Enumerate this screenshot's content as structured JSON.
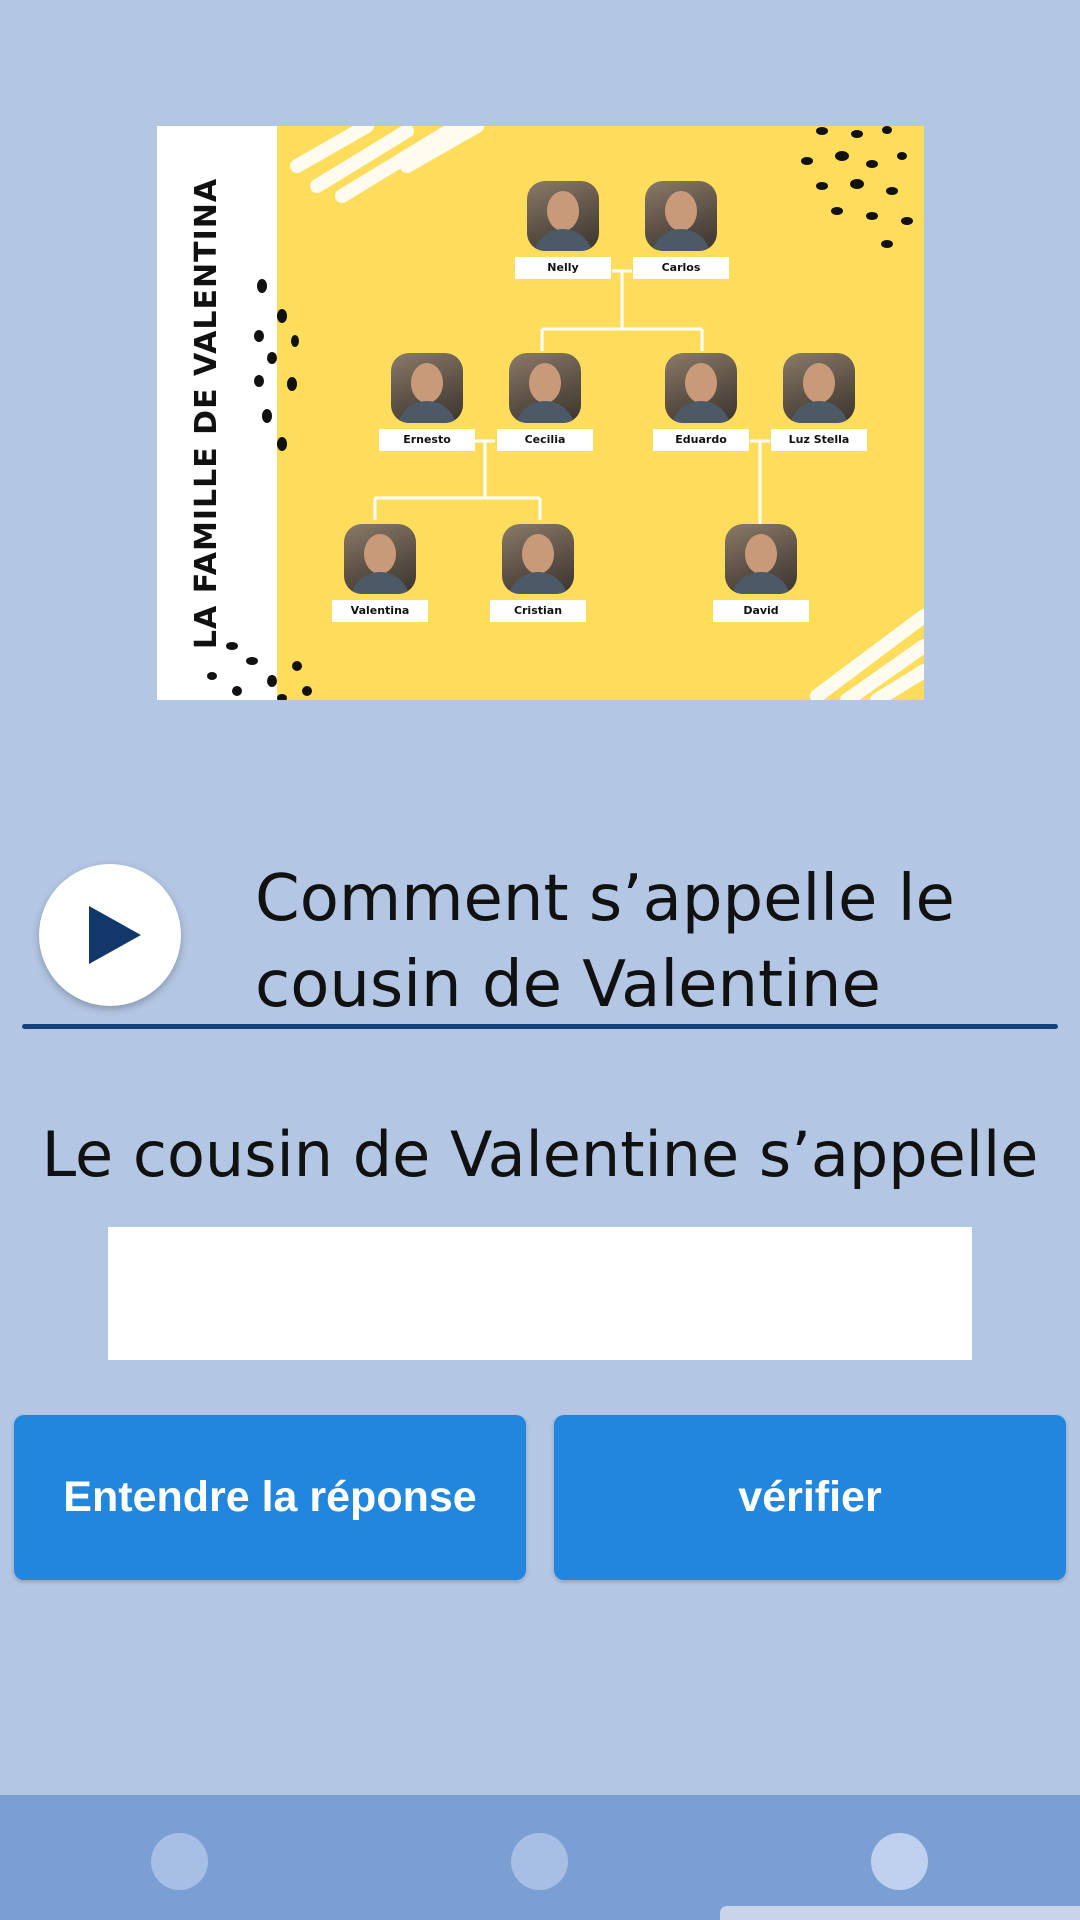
{
  "image": {
    "title": "LA FAMILLE DE VALENTINA",
    "people": {
      "nelly": "Nelly",
      "carlos": "Carlos",
      "ernesto": "Ernesto",
      "cecilia": "Cecilia",
      "eduardo": "Eduardo",
      "luz_stella": "Luz Stella",
      "valentina": "Valentina",
      "cristian": "Cristian",
      "david": "David"
    },
    "background_color": "#ffdd5c"
  },
  "question": {
    "text": "Comment s’appelle le cousin de Valentine",
    "play_icon": "play-icon"
  },
  "answer": {
    "prompt": "Le cousin de Valentine s’appelle",
    "value": "",
    "placeholder": ""
  },
  "buttons": {
    "listen_label": "Entendre la réponse",
    "verify_label": "vérifier"
  },
  "colors": {
    "page_background": "#b3c6e3",
    "button": "#2186de",
    "divider": "#14407d",
    "nav_bar": "#7b9fd3"
  }
}
